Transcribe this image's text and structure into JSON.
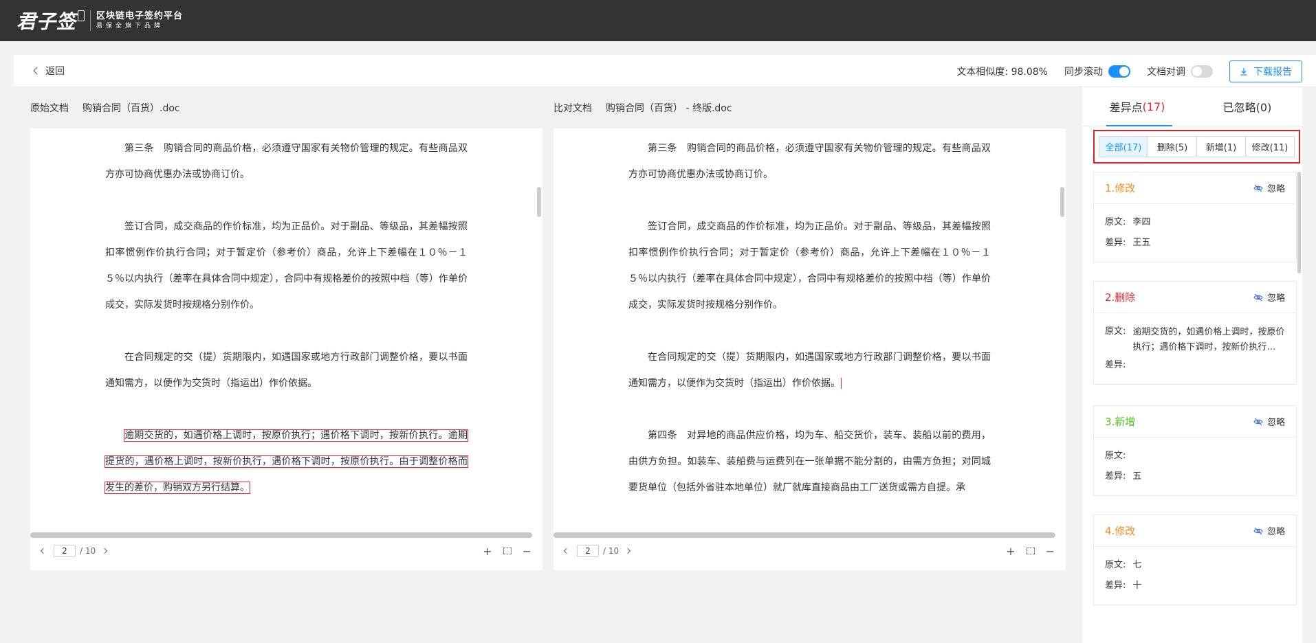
{
  "header": {
    "logo_text": "君子签",
    "platform_title": "区块链电子签约平台",
    "platform_subtitle": "易保全旗下品牌"
  },
  "toolbar": {
    "back_label": "返回",
    "similarity_label": "文本相似度: 98.08%",
    "sync_scroll_label": "同步滚动",
    "sync_scroll_on": true,
    "align_label": "文档对调",
    "align_on": false,
    "download_label": "下载报告"
  },
  "left_doc": {
    "label": "原始文档",
    "filename": "购销合同（百货）.doc",
    "paragraphs": [
      "第三条　购销合同的商品价格，必须遵守国家有关物价管理的规定。有些商品双方亦可协商优惠办法或协商订价。",
      "签订合同，成交商品的作价标准，均为正品价。对于副品、等级品，其差幅按照扣率惯例作价执行合同；对于暂定价（参考价）商品，允许上下差幅在１０％－１５％以内执行（差率在具体合同中规定），合同中有规格差价的按照中档（等）作单价成交，实际发货时按规格分别作价。",
      "在合同规定的交（提）货期限内，如遇国家或地方行政部门调整价格，要以书面通知需方，以便作为交货时（指运出）作价依据。",
      "逾期交货的，如遇价格上调时，按原价执行；遇价格下调时，按新价执行。逾期提货的，遇价格上调时，按新价执行，遇价格下调时，按原价执行。由于调整价格而发生的差价，购销双方另行结算。"
    ],
    "page_current": "2",
    "page_total": "/ 10"
  },
  "right_doc": {
    "label": "比对文档",
    "filename": "购销合同（百货） - 终版.doc",
    "paragraphs": [
      "第三条　购销合同的商品价格，必须遵守国家有关物价管理的规定。有些商品双方亦可协商优惠办法或协商订价。",
      "签订合同，成交商品的作价标准，均为正品价。对于副品、等级品，其差幅按照扣率惯例作价执行合同；对于暂定价（参考价）商品，允许上下差幅在１０％－１５％以内执行（差率在具体合同中规定），合同中有规格差价的按照中档（等）作单价成交，实际发货时按规格分别作价。",
      "在合同规定的交（提）货期限内，如遇国家或地方行政部门调整价格，要以书面通知需方，以便作为交货时（指运出）作价依据。",
      "第四条　对异地的商品供应价格，均为车、船交货价，装车、装船以前的费用，由供方负担。如装车、装船费与运费列在一张单据不能分割的，由需方负担；对同城要货单位（包括外省驻本地单位）就厂就库直接商品由工厂送货或需方自提。承"
    ],
    "page_current": "2",
    "page_total": "/ 10"
  },
  "panel": {
    "tab_diff_label": "差异点",
    "tab_diff_count": "(17)",
    "tab_ignored_label": "已忽略(0)",
    "filters": [
      "全部(17)",
      "删除(5)",
      "新增(1)",
      "修改(11)"
    ],
    "ignore_label": "忽略",
    "original_label": "原文:",
    "diff_label": "差异:",
    "cards": [
      {
        "title": "1.修改",
        "type": "modify",
        "original": "李四",
        "diff": "王五"
      },
      {
        "title": "2.删除",
        "type": "delete",
        "original": "逾期交货的，如遇价格上调时，按原价执行；遇价格下调时，按新价执行…",
        "diff": ""
      },
      {
        "title": "3.新增",
        "type": "add",
        "original": "",
        "diff": "五"
      },
      {
        "title": "4.修改",
        "type": "modify",
        "original": "七",
        "diff": "十"
      }
    ]
  },
  "colors": {
    "accent": "#1890ff",
    "topbar": "#333333",
    "highlight_red": "#f5222d",
    "modify_orange": "#fa8c16",
    "add_green": "#52c41a"
  }
}
